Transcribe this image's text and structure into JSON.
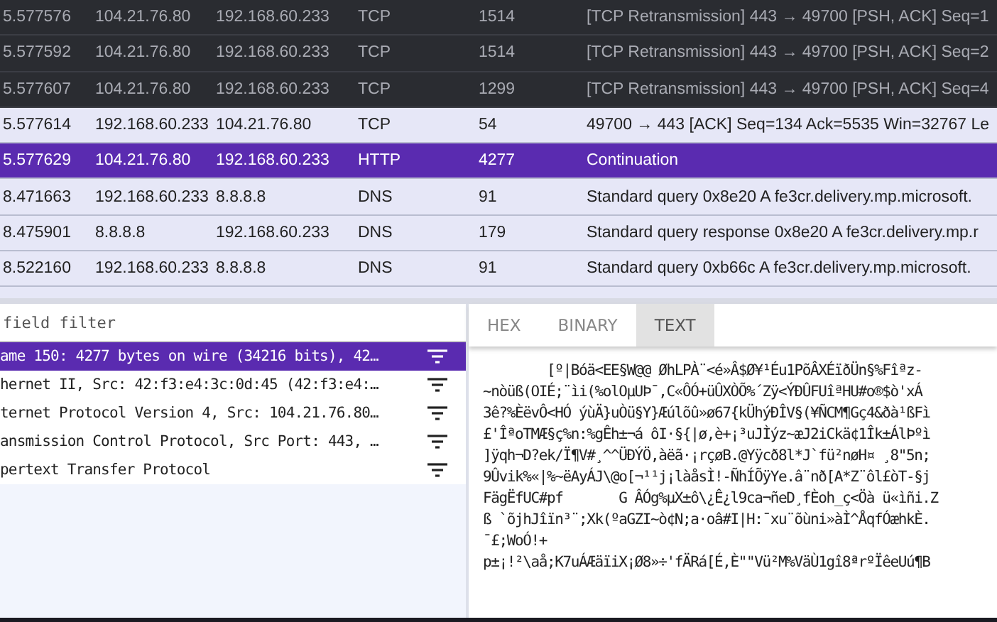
{
  "packets": [
    {
      "kind": "dark",
      "selected": false,
      "time": "5.577576",
      "source": "104.21.76.80",
      "destination": "192.168.60.233",
      "protocol": "TCP",
      "length": "1514",
      "info": "[TCP Retransmission] 443 → 49700 [PSH, ACK] Seq=1"
    },
    {
      "kind": "dark",
      "selected": false,
      "time": "5.577592",
      "source": "104.21.76.80",
      "destination": "192.168.60.233",
      "protocol": "TCP",
      "length": "1514",
      "info": "[TCP Retransmission] 443 → 49700 [PSH, ACK] Seq=2"
    },
    {
      "kind": "dark",
      "selected": false,
      "time": "5.577607",
      "source": "104.21.76.80",
      "destination": "192.168.60.233",
      "protocol": "TCP",
      "length": "1299",
      "info": "[TCP Retransmission] 443 → 49700 [PSH, ACK] Seq=4"
    },
    {
      "kind": "light",
      "selected": false,
      "time": "5.577614",
      "source": "192.168.60.233",
      "destination": "104.21.76.80",
      "protocol": "TCP",
      "length": "54",
      "info": "49700 → 443 [ACK] Seq=134 Ack=5535 Win=32767 Le"
    },
    {
      "kind": "light",
      "selected": true,
      "time": "5.577629",
      "source": "104.21.76.80",
      "destination": "192.168.60.233",
      "protocol": "HTTP",
      "length": "4277",
      "info": "Continuation"
    },
    {
      "kind": "light",
      "selected": false,
      "time": "8.471663",
      "source": "192.168.60.233",
      "destination": "8.8.8.8",
      "protocol": "DNS",
      "length": "91",
      "info": "Standard query 0x8e20 A fe3cr.delivery.mp.microsoft."
    },
    {
      "kind": "light",
      "selected": false,
      "time": "8.475901",
      "source": "8.8.8.8",
      "destination": "192.168.60.233",
      "protocol": "DNS",
      "length": "179",
      "info": "Standard query response 0x8e20 A fe3cr.delivery.mp.r"
    },
    {
      "kind": "light",
      "selected": false,
      "time": "8.522160",
      "source": "192.168.60.233",
      "destination": "8.8.8.8",
      "protocol": "DNS",
      "length": "91",
      "info": "Standard query 0xb66c A fe3cr.delivery.mp.microsoft."
    }
  ],
  "filter": {
    "placeholder": "field filter"
  },
  "tree": [
    {
      "label": "ame 150: 4277 bytes on wire (34216 bits), 42…",
      "selected": true
    },
    {
      "label": "hernet II, Src: 42:f3:e4:3c:0d:45 (42:f3:e4:…",
      "selected": false
    },
    {
      "label": "ternet Protocol Version 4, Src: 104.21.76.80…",
      "selected": false
    },
    {
      "label": "ansmission Control Protocol, Src Port: 443, …",
      "selected": false
    },
    {
      "label": "pertext Transfer Protocol",
      "selected": false
    }
  ],
  "tabs": [
    {
      "label": "HEX",
      "selected": false
    },
    {
      "label": "BINARY",
      "selected": false
    },
    {
      "label": "TEXT",
      "selected": true
    }
  ],
  "text_lines": [
    "        [º|Bóä<EE§W@@ ØhLPÀ¨<é»Â$Ø¥¹Éu1PõÂXÉïðÜn§%Fîªz-",
    "~nòüß(OIÉ;¨ìi(%olOµUÞ¯,C«ÔÓ+üÛXÒÕ%´Zÿ<ÝÐÛFUîªHU#o®$ò'xÁ",
    "3ê?%ÈëvÔ<HÓ ýùÄ}uÒü§Y}Æúlõû»ø67{kÜhýÐÎV§(¥ÑCM¶Gç4&ðà¹ßFì",
    "£'ÎªoTMÆ§ç%n:%gÊh±¬á ôI·§{|ø,è+¡³uJÌýz~æJ2iCkä¢1Îk±ÁlÞºì",
    "]ÿqh¬D?ek/Ï¶V#¸^^ÜÐÝÖ,àëã·¡rçøB.@Yÿcð8l*J`fü²nøH¤ ¸8\"5n;",
    "9Ûvik%«|%~ëAyÁJ\\@o[¬¹¹j¡làåsÌ!-ÑhÍÕÿYe.â¨nð[A*Z¨ôl£òT-§j",
    "FägËfUC#pf       G ÂÓg%µX±ô\\¿Ê¿l9ca¬ñeD¸fÈoh_ç<Öà ü«ìñi.Z",
    "ß `õjhJîïn³¨;Xk(ºaGZI~ò¢N;a·oâ#I|H:¯xu¨õùni»àÌ^ÅqfÓæhkÈ.",
    "¯£;WoÓ!+",
    "p±¡!²\\aå;K7uÁÆäïiX¡Ø8»÷'fÄRá[É,È\"\"Vü²M%VäÙ1gî8ªrºÏêeUú¶B"
  ]
}
